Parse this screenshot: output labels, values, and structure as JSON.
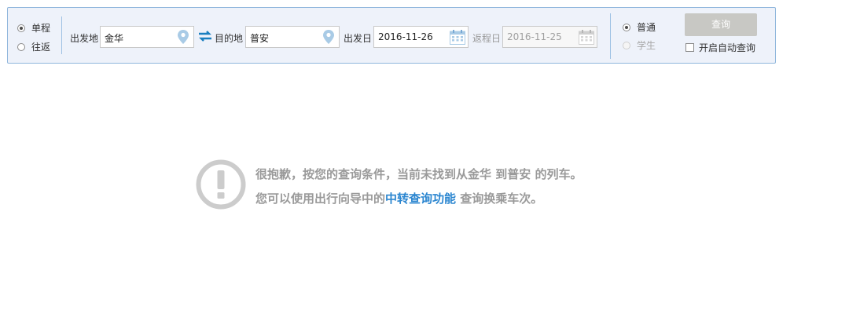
{
  "trip_type": {
    "options": [
      {
        "label": "单程",
        "selected": true
      },
      {
        "label": "往返",
        "selected": false
      }
    ]
  },
  "from": {
    "label": "出发地",
    "value": "金华",
    "icon": "location-pin-icon"
  },
  "swap_icon": "swap-arrows-icon",
  "to": {
    "label": "目的地",
    "value": "普安",
    "icon": "location-pin-icon"
  },
  "depart_date": {
    "label": "出发日",
    "value": "2016-11-26",
    "icon": "calendar-icon"
  },
  "return_date": {
    "label": "返程日",
    "placeholder": "2016-11-25",
    "disabled": true,
    "icon": "calendar-icon"
  },
  "passenger_type": {
    "options": [
      {
        "label": "普通",
        "selected": true,
        "disabled": false
      },
      {
        "label": "学生",
        "selected": false,
        "disabled": true
      }
    ]
  },
  "query_button": {
    "label": "查询"
  },
  "auto_query": {
    "label": "开启自动查询",
    "checked": false
  },
  "notice": {
    "icon": "exclamation-circle-icon",
    "text_before": "很抱歉，按您的查询条件，当前未找到从金华 到普安 的列车。您可以使用出行向导中的",
    "link": "中转查询功能",
    "text_after": " 查询换乘车次。"
  },
  "colors": {
    "accent": "#2b86d0",
    "panel_bg": "#eef2fa",
    "panel_border": "#8fb6dc",
    "icon_blue": "#a9cbe6",
    "button_disabled": "#c8c8c4",
    "notice_gray": "#9a9a9a",
    "notice_icon_gray": "#cccccc"
  }
}
